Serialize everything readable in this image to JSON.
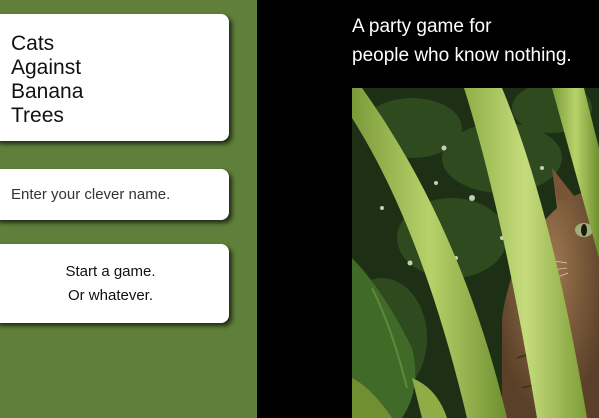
{
  "sidebar": {
    "title_lines": [
      "Cats",
      "Against",
      "Banana",
      "Trees"
    ],
    "name_input": {
      "placeholder": "Enter your clever name.",
      "value": ""
    },
    "start_button": {
      "line1": "Start a game.",
      "line2": "Or whatever."
    }
  },
  "main": {
    "tagline_line1": "A party game for",
    "tagline_line2": "people who know nothing.",
    "photo": {
      "icon": "cat-behind-banana-leaves-photo"
    }
  },
  "colors": {
    "sidebar_bg": "#5f7f3a",
    "main_bg": "#000000",
    "card_bg": "#ffffff"
  }
}
